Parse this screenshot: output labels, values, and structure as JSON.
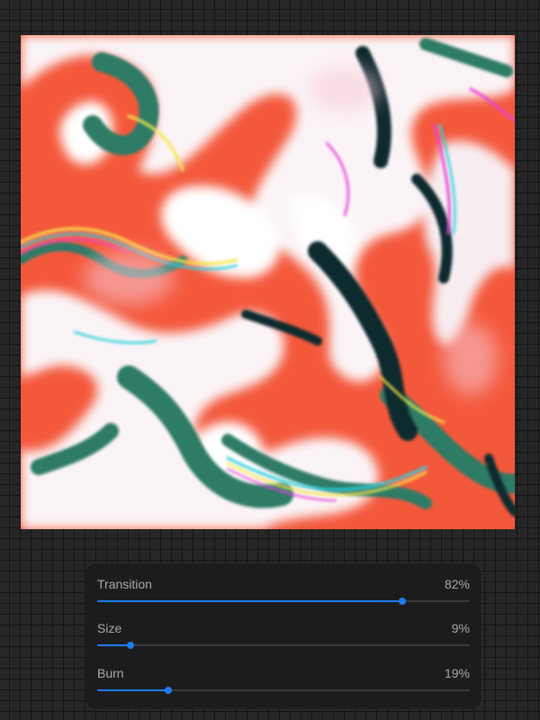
{
  "canvas": {
    "colors": {
      "orange": "#f4583b",
      "white": "#fbf4f6",
      "teal": "#2f7b66",
      "dark": "#0f2b2f",
      "cyan": "#2ad3e0",
      "magenta": "#e644d6",
      "yellow": "#f6e84a",
      "pink": "#f7c9d6"
    }
  },
  "adjustments": {
    "sliders": [
      {
        "label": "Transition",
        "value_text": "82%",
        "value": 0.82
      },
      {
        "label": "Size",
        "value_text": "9%",
        "value": 0.09
      },
      {
        "label": "Burn",
        "value_text": "19%",
        "value": 0.19
      }
    ],
    "accent": "#1c7cf2"
  }
}
